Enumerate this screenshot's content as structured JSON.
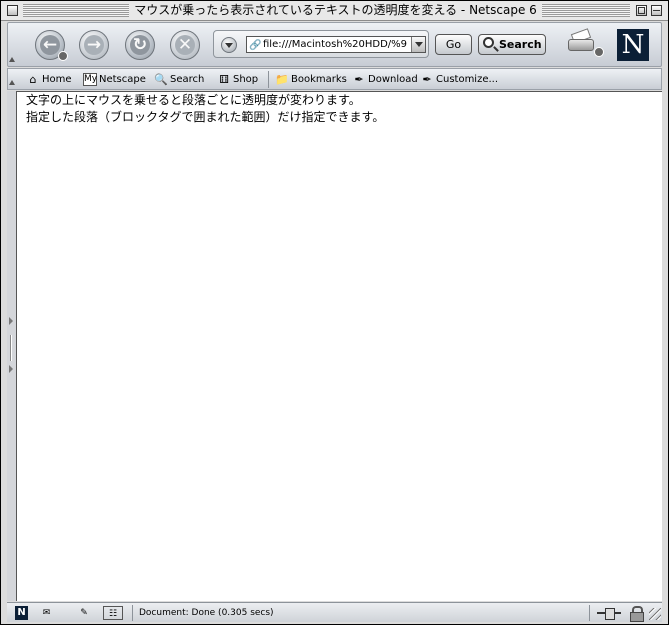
{
  "window": {
    "title": "マウスが乗ったら表示されているテキストの透明度を変える - Netscape 6"
  },
  "navbar": {
    "back_icon": "back-arrow-icon",
    "forward_icon": "forward-arrow-icon",
    "reload_icon": "reload-icon",
    "stop_icon": "stop-icon",
    "url_value": "file:///Macintosh%20HDD/%9",
    "go_label": "Go",
    "search_label": "Search"
  },
  "personal_toolbar": {
    "home": "Home",
    "my_badge": "My",
    "netscape": "Netscape",
    "search": "Search",
    "shop": "Shop",
    "bookmarks": "Bookmarks",
    "download": "Download",
    "customize": "Customize..."
  },
  "content": {
    "lines": [
      "文字の上にマウスを乗せると段落ごとに透明度が変わります。",
      "指定した段落（ブロックタグで囲まれた範囲）だけ指定できます。"
    ]
  },
  "statusbar": {
    "logo_letter": "N",
    "status_text": "Document: Done (0.305 secs)"
  },
  "colors": {
    "chrome_gradient_top": "#eef1f5",
    "chrome_gradient_bottom": "#c7ccd4",
    "netscape_logo_bg": "#0b1f36"
  }
}
